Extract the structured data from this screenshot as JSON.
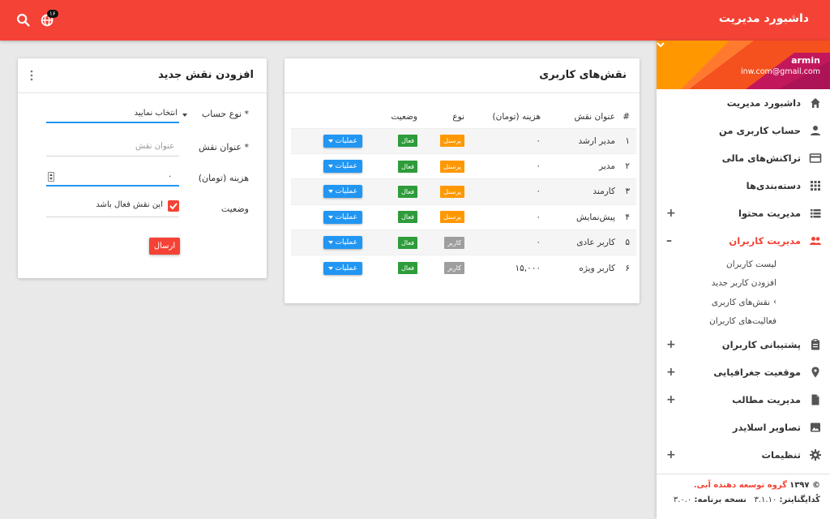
{
  "app": {
    "title": "داشبورد مدیریت",
    "notifications_count": "۱۶"
  },
  "user": {
    "name": "armin",
    "email": "inw.com@gmail.com"
  },
  "sidebar": {
    "items": [
      {
        "label": "داشبورد مدیریت",
        "icon": "home-icon",
        "expandable": false
      },
      {
        "label": "حساب کاربری من",
        "icon": "person-icon",
        "expandable": false
      },
      {
        "label": "تراکنش‌های مالی",
        "icon": "credit-card-icon",
        "expandable": false
      },
      {
        "label": "دسته‌بندی‌ها",
        "icon": "grid-icon",
        "expandable": false
      },
      {
        "label": "مدیریت محتوا",
        "icon": "list-icon",
        "expandable": true,
        "toggle": "+"
      },
      {
        "label": "مدیریت کاربران",
        "icon": "people-icon",
        "expandable": true,
        "toggle": "–",
        "active": true
      },
      {
        "label": "پشتیبانی کاربران",
        "icon": "clipboard-icon",
        "expandable": true,
        "toggle": "+"
      },
      {
        "label": "موقعیت جغرافیایی",
        "icon": "location-pin-icon",
        "expandable": true,
        "toggle": "+"
      },
      {
        "label": "مدیریت مطالب",
        "icon": "document-icon",
        "expandable": true,
        "toggle": "+"
      },
      {
        "label": "تصاویر اسلایدر",
        "icon": "image-icon",
        "expandable": false
      },
      {
        "label": "تنظیمات",
        "icon": "gear-icon",
        "expandable": true,
        "toggle": "+"
      }
    ],
    "users_submenu": [
      {
        "label": "لیست کاربران"
      },
      {
        "label": "افزودن کاربر جدید"
      },
      {
        "label": "نقش‌های کاربری",
        "current": true
      },
      {
        "label": "فعالیت‌های کاربران"
      }
    ],
    "footer": {
      "copyright": "© ۱۳۹۷",
      "org": "گروه توسعه دهنده آبی.",
      "codeigniter_label": "کُدایگنایتر:",
      "codeigniter_version": "۳.۱.۱۰",
      "app_version_label": "نسخه برنامه:",
      "app_version": "۳.۰.۰"
    }
  },
  "roles_card": {
    "title": "نقش‌های کاربری",
    "columns": [
      "#",
      "عنوان نقش",
      "هزینه (تومان)",
      "نوع",
      "وضعیت",
      ""
    ],
    "rows": [
      {
        "num": "۱",
        "title": "مدیر ارشد",
        "cost": "۰",
        "type": "پرسنل",
        "type_color": "orange",
        "status": "فعال",
        "ops": "عملیات"
      },
      {
        "num": "۲",
        "title": "مدیر",
        "cost": "۰",
        "type": "پرسنل",
        "type_color": "orange",
        "status": "فعال",
        "ops": "عملیات"
      },
      {
        "num": "۳",
        "title": "کارمند",
        "cost": "۰",
        "type": "پرسنل",
        "type_color": "orange",
        "status": "فعال",
        "ops": "عملیات"
      },
      {
        "num": "۴",
        "title": "پیش‌نمایش",
        "cost": "۰",
        "type": "پرسنل",
        "type_color": "orange",
        "status": "فعال",
        "ops": "عملیات"
      },
      {
        "num": "۵",
        "title": "کاربر عادی",
        "cost": "۰",
        "type": "کاربر",
        "type_color": "grey",
        "status": "فعال",
        "ops": "عملیات"
      },
      {
        "num": "۶",
        "title": "کاربر ویژه",
        "cost": "۱۵,۰۰۰",
        "type": "کاربر",
        "type_color": "grey",
        "status": "فعال",
        "ops": "عملیات"
      }
    ]
  },
  "add_card": {
    "title": "افزودن نقش جدید",
    "account_type_label": "نوع حساب *",
    "account_type_value": "انتخاب نمایید",
    "role_title_label": "عنوان نقش *",
    "role_title_placeholder": "عنوان نقش",
    "cost_label": "هزینه (تومان)",
    "cost_value": "۰",
    "status_label": "وضعیت",
    "active_checkbox_label": "این نقش فعال باشد",
    "active_checked": true,
    "submit_label": "ارسال"
  },
  "colors": {
    "primary": "#f44336",
    "accent_blue": "#2196f3",
    "label_orange": "#ff9800",
    "label_grey": "#9e9e9e",
    "label_green": "#2e9c3a"
  }
}
